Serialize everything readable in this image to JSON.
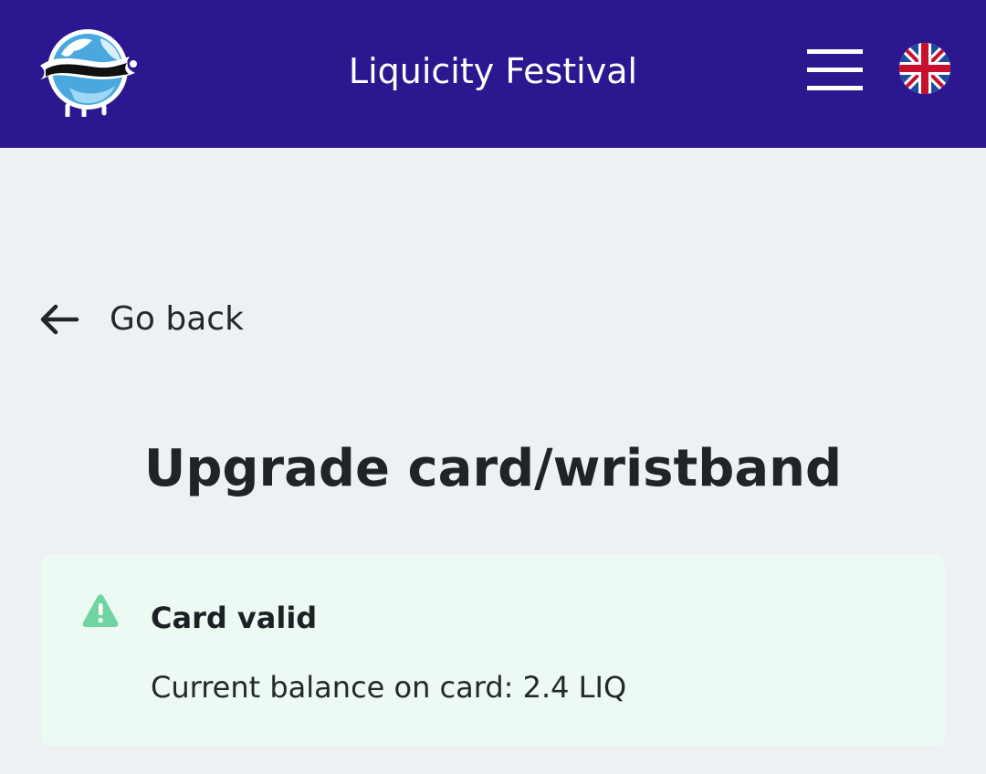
{
  "header": {
    "title": "Liquicity Festival",
    "logo_icon": "liquicity-globe-logo",
    "menu_icon": "hamburger-menu-icon",
    "language_icon": "uk-flag-icon",
    "background_color": "#2d1791"
  },
  "navigation": {
    "back_label": "Go back",
    "back_icon": "arrow-left-icon"
  },
  "page": {
    "title": "Upgrade card/wristband"
  },
  "alert": {
    "icon": "warning-triangle-icon",
    "title": "Card valid",
    "message": "Current balance on card: 2.4 LIQ",
    "background_color": "#edf9f3",
    "icon_color": "#6fd4a0"
  }
}
